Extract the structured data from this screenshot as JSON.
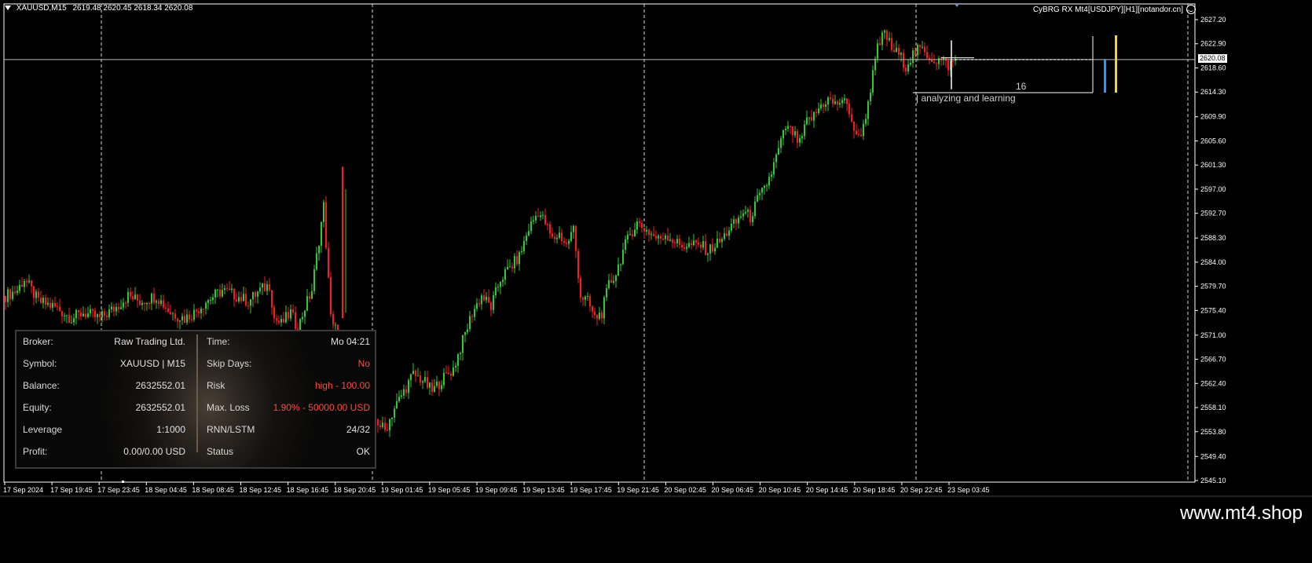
{
  "header": {
    "symbol_line": "XAUUSD,M15",
    "ohlc": "2619.48 2620.45 2618.34 2620.08",
    "ea_name": "CyBRG RX Mt4[USDJPY][H1][notandor.cn]"
  },
  "current_price": "2620.08",
  "overlay": {
    "count": "16",
    "note": "analyzing and learning"
  },
  "panel": {
    "left": [
      {
        "label": "Broker:",
        "value": "Raw Trading Ltd."
      },
      {
        "label": "Symbol:",
        "value": "XAUUSD | M15"
      },
      {
        "label": "Balance:",
        "value": "2632552.01"
      },
      {
        "label": "Equity:",
        "value": "2632552.01"
      },
      {
        "label": "Leverage",
        "value": "1:1000"
      },
      {
        "label": "Profit:",
        "value": "0.00/0.00 USD"
      }
    ],
    "right": [
      {
        "label": "Time:",
        "value": "Mo 04:21",
        "red": false
      },
      {
        "label": "Skip Days:",
        "value": "No",
        "red": true
      },
      {
        "label": "Risk",
        "value": "high - 100.00",
        "red": true
      },
      {
        "label": "Max. Loss",
        "value": "1.90% - 50000.00 USD",
        "red": true
      },
      {
        "label": "RNN/LSTM",
        "value": "24/32",
        "red": false
      },
      {
        "label": "Status",
        "value": "OK",
        "red": false
      }
    ]
  },
  "watermark": "www.mt4.shop",
  "colors": {
    "bull": "#2ecc2e",
    "bear": "#ff1a1a",
    "grid": "#ffffff",
    "axis_text": "#ffffff",
    "accent_blue": "#1e9bff",
    "accent_yellow": "#ffd21f"
  },
  "chart_data": {
    "type": "candlestick",
    "symbol": "XAUUSD",
    "timeframe": "M15",
    "ylim": [
      2545.1,
      2627.2
    ],
    "y_ticks": [
      "2627.20",
      "2622.90",
      "2618.60",
      "2614.30",
      "2609.90",
      "2605.60",
      "2601.30",
      "2597.00",
      "2592.70",
      "2588.30",
      "2584.00",
      "2579.70",
      "2575.40",
      "2571.00",
      "2566.70",
      "2562.40",
      "2558.10",
      "2553.80",
      "2549.40",
      "2545.10"
    ],
    "x_ticks": [
      "17 Sep 2024",
      "17 Sep 19:45",
      "17 Sep 23:45",
      "18 Sep 04:45",
      "18 Sep 08:45",
      "18 Sep 12:45",
      "18 Sep 16:45",
      "18 Sep 20:45",
      "19 Sep 01:45",
      "19 Sep 05:45",
      "19 Sep 09:45",
      "19 Sep 13:45",
      "19 Sep 17:45",
      "19 Sep 21:45",
      "20 Sep 02:45",
      "20 Sep 06:45",
      "20 Sep 10:45",
      "20 Sep 14:45",
      "20 Sep 18:45",
      "20 Sep 22:45",
      "23 Sep 03:45"
    ],
    "price_path": [
      [
        0,
        2578
      ],
      [
        5,
        2579
      ],
      [
        8,
        2581
      ],
      [
        14,
        2577
      ],
      [
        21,
        2576
      ],
      [
        28,
        2574
      ],
      [
        33,
        2575
      ],
      [
        40,
        2574
      ],
      [
        47,
        2576
      ],
      [
        52,
        2578
      ],
      [
        57,
        2577
      ],
      [
        64,
        2578
      ],
      [
        70,
        2575
      ],
      [
        76,
        2574
      ],
      [
        80,
        2575
      ],
      [
        85,
        2577
      ],
      [
        92,
        2579
      ],
      [
        98,
        2578
      ],
      [
        103,
        2577
      ],
      [
        108,
        2579
      ],
      [
        112,
        2580
      ],
      [
        114,
        2574
      ],
      [
        117,
        2573
      ],
      [
        121,
        2575
      ],
      [
        124,
        2572
      ],
      [
        127,
        2576
      ],
      [
        130,
        2579
      ],
      [
        135,
        2594
      ],
      [
        138,
        2574
      ],
      [
        140,
        2573
      ],
      [
        143,
        2560
      ],
      [
        147,
        2558
      ],
      [
        152,
        2557
      ],
      [
        157,
        2556
      ],
      [
        161,
        2554
      ],
      [
        165,
        2558
      ],
      [
        169,
        2561
      ],
      [
        173,
        2564
      ],
      [
        177,
        2563
      ],
      [
        181,
        2561
      ],
      [
        185,
        2563
      ],
      [
        190,
        2565
      ],
      [
        194,
        2570
      ],
      [
        198,
        2575
      ],
      [
        202,
        2578
      ],
      [
        206,
        2576
      ],
      [
        210,
        2581
      ],
      [
        214,
        2583
      ],
      [
        218,
        2585
      ],
      [
        222,
        2590
      ],
      [
        226,
        2593
      ],
      [
        229,
        2591
      ],
      [
        232,
        2588
      ],
      [
        235,
        2589
      ],
      [
        238,
        2587
      ],
      [
        241,
        2590
      ],
      [
        244,
        2578
      ],
      [
        247,
        2577
      ],
      [
        250,
        2574
      ],
      [
        253,
        2575
      ],
      [
        256,
        2580
      ],
      [
        259,
        2582
      ],
      [
        262,
        2586
      ],
      [
        265,
        2589
      ],
      [
        268,
        2591
      ],
      [
        271,
        2590
      ],
      [
        274,
        2589
      ],
      [
        277,
        2588
      ],
      [
        280,
        2589
      ],
      [
        283,
        2588
      ],
      [
        286,
        2587
      ],
      [
        289,
        2587
      ],
      [
        292,
        2587
      ],
      [
        295,
        2587
      ],
      [
        298,
        2586
      ],
      [
        301,
        2587
      ],
      [
        304,
        2588
      ],
      [
        307,
        2590
      ],
      [
        310,
        2591
      ],
      [
        313,
        2593
      ],
      [
        316,
        2592
      ],
      [
        319,
        2595
      ],
      [
        322,
        2597
      ],
      [
        325,
        2600
      ],
      [
        328,
        2604
      ],
      [
        331,
        2608
      ],
      [
        334,
        2607
      ],
      [
        337,
        2605
      ],
      [
        340,
        2609
      ],
      [
        343,
        2610
      ],
      [
        346,
        2612
      ],
      [
        349,
        2613
      ],
      [
        352,
        2612
      ],
      [
        355,
        2613
      ],
      [
        358,
        2611
      ],
      [
        361,
        2606
      ],
      [
        364,
        2608
      ],
      [
        367,
        2615
      ],
      [
        370,
        2622
      ],
      [
        373,
        2625
      ],
      [
        376,
        2622
      ],
      [
        379,
        2621
      ],
      [
        382,
        2619
      ],
      [
        385,
        2621
      ],
      [
        388,
        2622
      ],
      [
        391,
        2621
      ],
      [
        394,
        2620
      ],
      [
        397,
        2620
      ],
      [
        400,
        2619
      ],
      [
        403,
        2620
      ]
    ]
  }
}
